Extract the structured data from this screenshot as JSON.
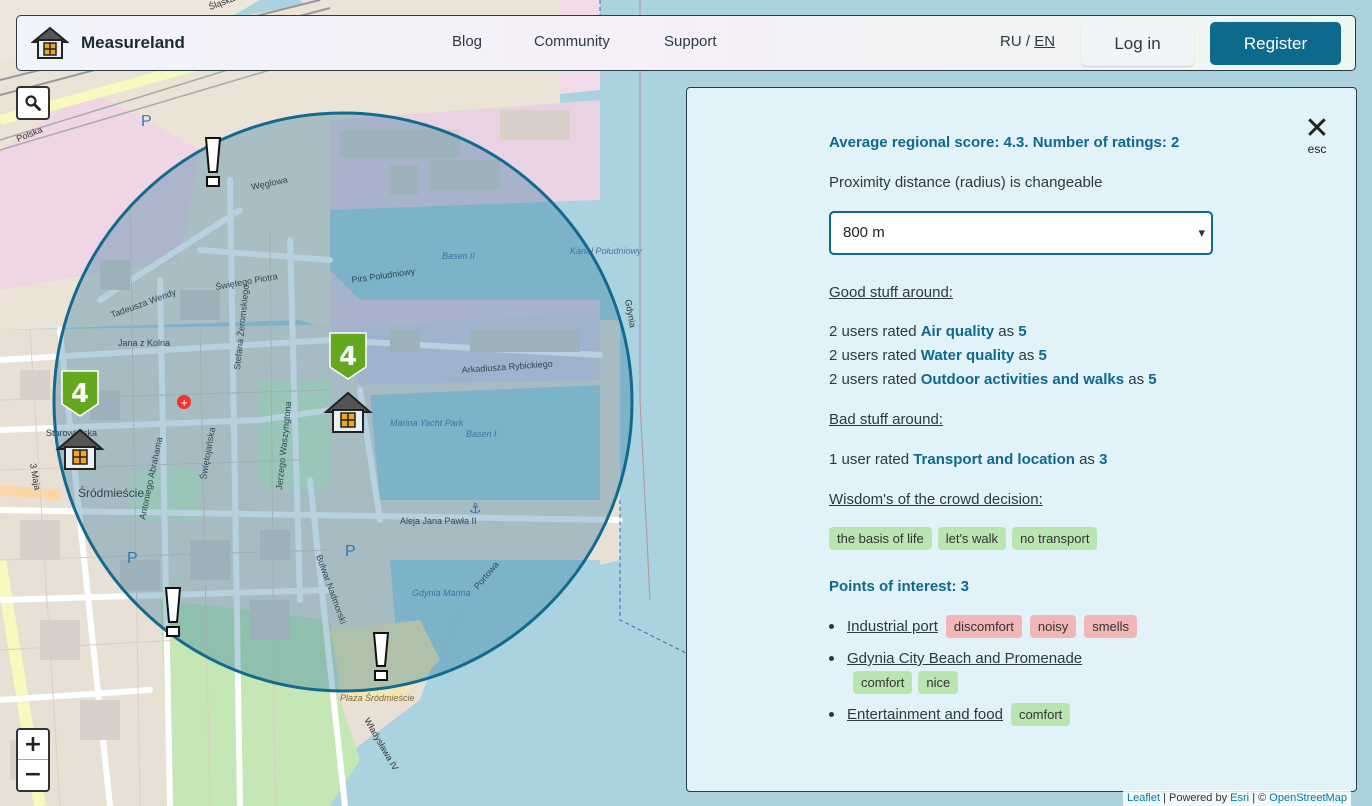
{
  "header": {
    "brand": "Measureland",
    "nav": [
      "Blog",
      "Community",
      "Support"
    ],
    "lang_ru": "RU",
    "lang_sep": "/",
    "lang_en": "EN",
    "login": "Log in",
    "register": "Register"
  },
  "map": {
    "labels": [
      "Polska",
      "Węglowa",
      "Pirs Południowy",
      "Basen II",
      "Kanał Południowy",
      "Gdynia",
      "Świętego Piotra",
      "Tadeusza Wendy",
      "Jana z Kolna",
      "Arkadiusza Rybickiego",
      "Marina Yacht Park",
      "Basen I",
      "Starowiejska",
      "Śródmieście",
      "Aleja Jana Pawła II",
      "Gdynia Marina",
      "Plaża Śródmieście",
      "3 Maja",
      "Bulwar Nadmorski",
      "Świętojańska",
      "Jerzego Waszyngtona",
      "Antoniego Abrahama",
      "Władysława IV",
      "Portowa",
      "Stefana Żeromskiego",
      "Śląska"
    ],
    "marker_score": "4",
    "marker_score_2": "4",
    "parking": "P"
  },
  "panel": {
    "close_label": "esc",
    "average": "Average regional score: 4.3. Number of ratings: 2",
    "proximity": "Proximity distance (radius) is changeable",
    "select_value": "800 m",
    "good_head": "Good stuff around:",
    "good": [
      {
        "pre": "2 users rated",
        "cat": "Air quality",
        "mid": "as",
        "score": "5"
      },
      {
        "pre": "2 users rated",
        "cat": "Water quality",
        "mid": "as",
        "score": "5"
      },
      {
        "pre": "2 users rated",
        "cat": "Outdoor activities and walks",
        "mid": "as",
        "score": "5"
      }
    ],
    "bad_head": "Bad stuff around:",
    "bad": [
      {
        "pre": "1 user rated",
        "cat": "Transport and location",
        "mid": "as",
        "score": "3"
      }
    ],
    "wisdom_head": "Wisdom's of the crowd decision:",
    "wisdom_tags": [
      "the basis of life",
      "let's walk",
      "no transport"
    ],
    "poi_head": "Points of interest: 3",
    "pois": [
      {
        "name": "Industrial port",
        "tags": [
          "discomfort",
          "noisy",
          "smells"
        ]
      },
      {
        "name": "Gdynia City Beach and Promenade",
        "tags": [
          "comfort",
          "nice"
        ]
      },
      {
        "name": "Entertainment and food",
        "tags": [
          "comfort"
        ]
      }
    ]
  },
  "attribution": {
    "leaflet": "Leaflet",
    "powered": "| Powered by",
    "esri": "Esri",
    "sep": "| ©",
    "osm": "OpenStreetMap"
  }
}
